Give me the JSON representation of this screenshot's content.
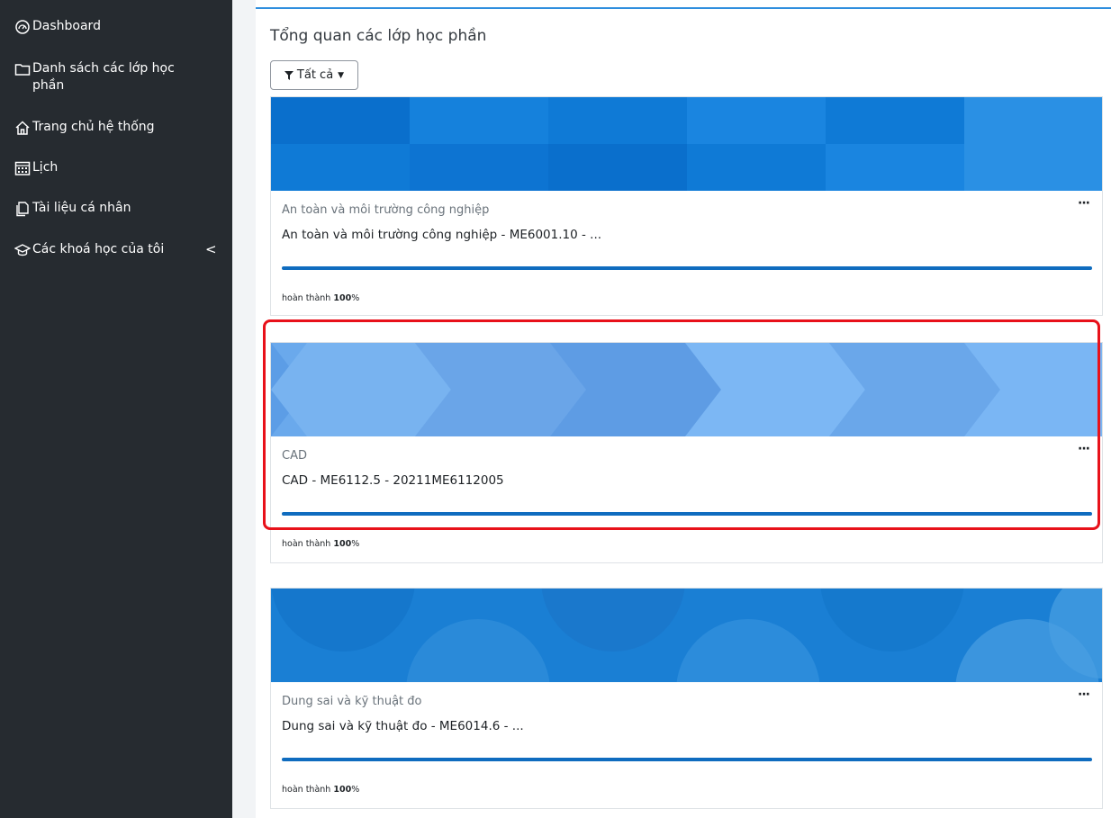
{
  "sidebar": {
    "items": [
      {
        "label": "Dashboard",
        "icon": "dashboard-gauge-icon"
      },
      {
        "label": "Danh sách các lớp học phần",
        "icon": "folder-icon"
      },
      {
        "label": "Trang chủ hệ thống",
        "icon": "home-icon"
      },
      {
        "label": "Lịch",
        "icon": "calendar-icon"
      },
      {
        "label": "Tài liệu cá nhân",
        "icon": "file-icon"
      },
      {
        "label": "Các khoá học của tôi",
        "icon": "graduation-cap-icon",
        "chevron": "<"
      }
    ]
  },
  "main": {
    "title": "Tổng quan các lớp học phần",
    "filter": {
      "label": "Tất cả",
      "icon": "filter-icon"
    },
    "courses": [
      {
        "category": "An toàn và môi trường công nghiệp",
        "name": "An toàn và môi trường công nghiệp - ME6001.10 - ...",
        "progress_prefix": "hoàn thành",
        "progress_value": "100",
        "progress_unit": "%",
        "progress_fraction": 1.0,
        "menu": "···",
        "banner_color": "#0f7ad6"
      },
      {
        "category": "CAD",
        "name": "CAD - ME6112.5 - 20211ME6112005",
        "progress_prefix": "hoàn thành",
        "progress_value": "100",
        "progress_unit": "%",
        "progress_fraction": 1.0,
        "menu": "···",
        "banner_color": "#6aa9ec"
      },
      {
        "category": "Dung sai và kỹ thuật đo",
        "name": "Dung sai và kỹ thuật đo - ME6014.6 - ...",
        "progress_prefix": "hoàn thành",
        "progress_value": "100",
        "progress_unit": "%",
        "progress_fraction": 1.0,
        "menu": "···",
        "banner_color": "#1a7fd4"
      }
    ]
  },
  "colors": {
    "accent": "#0f6cbf",
    "highlight": "#e8111a",
    "sidebar": "#262b30"
  }
}
